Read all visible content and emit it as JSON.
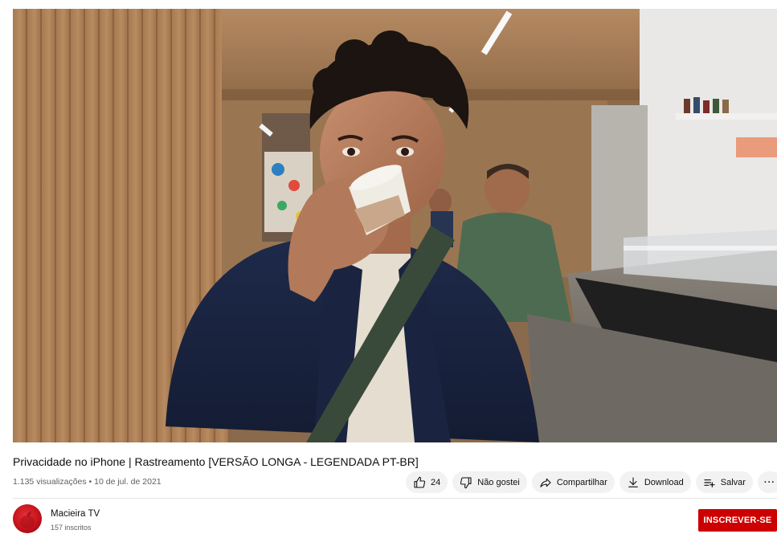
{
  "video": {
    "title": "Privacidade no iPhone | Rastreamento [VERSÃO LONGA - LEGENDADA PT-BR]",
    "meta": "1.135 visualizações • 10 de jul. de 2021"
  },
  "actions": {
    "like_count": "24",
    "dislike_label": "Não gostei",
    "share_label": "Compartilhar",
    "download_label": "Download",
    "save_label": "Salvar",
    "more_label": "···"
  },
  "channel": {
    "name": "Macieira TV",
    "subscribers": "157 inscritos",
    "subscribe_label": "INSCREVER-SE"
  },
  "colors": {
    "subscribe": "#cc0000",
    "pill_bg": "#f2f2f2",
    "meta_text": "#606060"
  },
  "icons": {
    "like": "thumbs-up-icon",
    "dislike": "thumbs-down-icon",
    "share": "share-arrow-icon",
    "download": "download-icon",
    "save": "playlist-add-icon",
    "more": "more-horizontal-icon"
  }
}
